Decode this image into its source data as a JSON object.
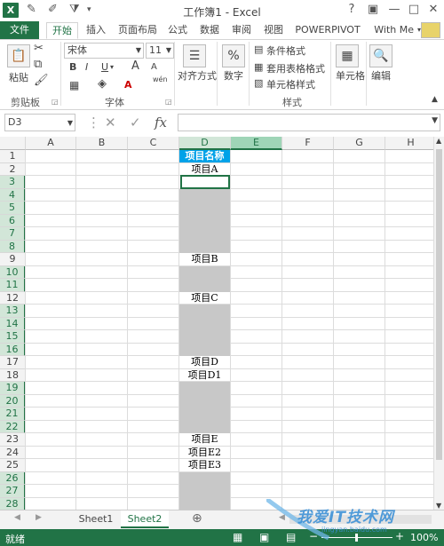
{
  "window": {
    "title": "工作簿1 - Excel",
    "controls": [
      "?",
      "□",
      "—",
      "□",
      "✕"
    ]
  },
  "ribbon_tabs": [
    "文件",
    "开始",
    "插入",
    "页面布局",
    "公式",
    "数据",
    "审阅",
    "视图",
    "POWERPIVOT"
  ],
  "active_tab": "开始",
  "user": "With Me",
  "ribbon": {
    "clipboard": {
      "paste": "粘贴",
      "label": "剪贴板"
    },
    "font": {
      "name": "宋体",
      "size": "11",
      "bold": "B",
      "italic": "I",
      "underline": "U",
      "grow": "A",
      "shrink": "A",
      "color": "A",
      "phonetic": "wén",
      "label": "字体"
    },
    "alignment": {
      "label": "对齐方式"
    },
    "number": {
      "label": "数字",
      "icon": "%"
    },
    "styles": {
      "conditional": "条件格式",
      "table": "套用表格格式",
      "cell_styles": "单元格样式",
      "label": "样式"
    },
    "cells": {
      "label": "单元格"
    },
    "editing": {
      "label": "编辑"
    }
  },
  "formula_bar": {
    "name_box": "D3",
    "fx": "fx",
    "value": ""
  },
  "columns": [
    "A",
    "B",
    "C",
    "D",
    "E",
    "F",
    "G",
    "H"
  ],
  "rows": [
    "1",
    "2",
    "3",
    "4",
    "5",
    "6",
    "7",
    "8",
    "9",
    "10",
    "11",
    "12",
    "13",
    "14",
    "15",
    "16",
    "17",
    "18",
    "19",
    "20",
    "21",
    "22",
    "23",
    "24",
    "25",
    "26",
    "27",
    "28"
  ],
  "cells_d": {
    "1": "项目名称",
    "2": "项目A",
    "9": "项目B",
    "12": "项目C",
    "17": "项目D",
    "18": "项目D1",
    "23": "项目E",
    "24": "项目E2",
    "25": "项目E3"
  },
  "gray_rows": [
    "4",
    "5",
    "6",
    "7",
    "8",
    "10",
    "11",
    "13",
    "14",
    "15",
    "16",
    "19",
    "20",
    "21",
    "22",
    "26",
    "27",
    "28"
  ],
  "sheet_tabs": [
    "Sheet1",
    "Sheet2"
  ],
  "active_sheet": "Sheet2",
  "status": {
    "ready": "就绪",
    "zoom": "100%"
  },
  "watermark": {
    "text": "我爱IT技术网",
    "url": "jingyan.baidu.com"
  },
  "colors": {
    "accent": "#217346",
    "header_fill": "#00a2e8",
    "gray_fill": "#c8c8c8"
  }
}
